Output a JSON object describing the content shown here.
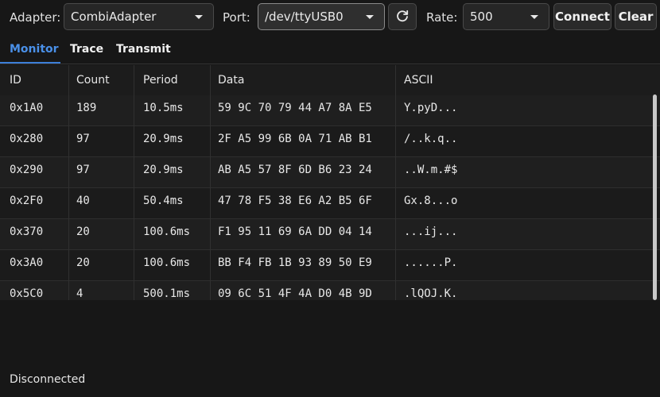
{
  "toolbar": {
    "adapter_label": "Adapter:",
    "adapter_value": "CombiAdapter",
    "port_label": "Port:",
    "port_value": "/dev/ttyUSB0",
    "rate_label": "Rate:",
    "rate_value": "500",
    "connect_label": "Connect",
    "clear_label": "Clear",
    "refresh_icon": "refresh-icon"
  },
  "tabs": [
    {
      "label": "Monitor",
      "active": true
    },
    {
      "label": "Trace",
      "active": false
    },
    {
      "label": "Transmit",
      "active": false
    }
  ],
  "table": {
    "columns": [
      "ID",
      "Count",
      "Period",
      "Data",
      "ASCII"
    ],
    "rows": [
      {
        "id": "0x1A0",
        "count": "189",
        "period": "10.5ms",
        "data": "59 9C 70 79 44 A7 8A E5",
        "ascii": "Y.pyD..."
      },
      {
        "id": "0x280",
        "count": "97",
        "period": "20.9ms",
        "data": "2F A5 99 6B 0A 71 AB B1",
        "ascii": "/..k.q.."
      },
      {
        "id": "0x290",
        "count": "97",
        "period": "20.9ms",
        "data": "AB A5 57 8F 6D B6 23 24",
        "ascii": "..W.m.#$"
      },
      {
        "id": "0x2F0",
        "count": "40",
        "period": "50.4ms",
        "data": "47 78 F5 38 E6 A2 B5 6F",
        "ascii": "Gx.8...o"
      },
      {
        "id": "0x370",
        "count": "20",
        "period": "100.6ms",
        "data": "F1 95 11 69 6A DD 04 14",
        "ascii": "...ij..."
      },
      {
        "id": "0x3A0",
        "count": "20",
        "period": "100.6ms",
        "data": "BB F4 FB 1B 93 89 50 E9",
        "ascii": "......P."
      },
      {
        "id": "0x5C0",
        "count": "4",
        "period": "500.1ms",
        "data": "09 6C 51 4F 4A D0 4B 9D",
        "ascii": ".lQOJ.K."
      }
    ]
  },
  "status": "Disconnected",
  "colors": {
    "accent": "#4a90e8",
    "background": "#171717"
  }
}
